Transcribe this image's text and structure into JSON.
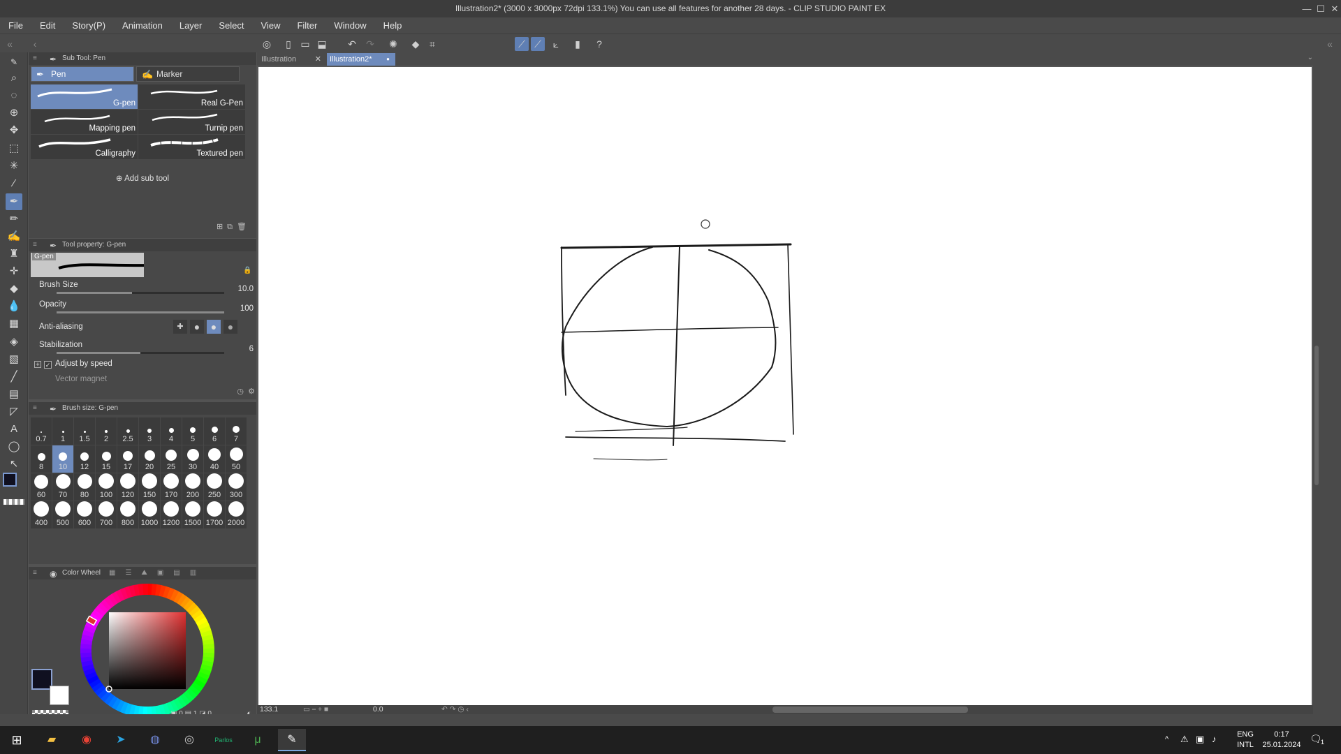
{
  "window": {
    "title": "Illustration2* (3000 x 3000px 72dpi 133.1%)  You can use all features for another 28 days. - CLIP STUDIO PAINT EX",
    "minimize": "—",
    "maximize": "☐",
    "close": "✕"
  },
  "menu": [
    "File",
    "Edit",
    "Story(P)",
    "Animation",
    "Layer",
    "Select",
    "View",
    "Filter",
    "Window",
    "Help"
  ],
  "subtool_panel": {
    "header": "Sub Tool: Pen",
    "tabs": [
      "Pen",
      "Marker"
    ],
    "brushes": [
      "G-pen",
      "Real G-Pen",
      "Mapping pen",
      "Turnip pen",
      "Calligraphy",
      "Textured pen"
    ],
    "add_sub_tool": "Add sub tool"
  },
  "tool_property": {
    "header": "Tool property: G-pen",
    "preview_label": "G-pen",
    "brush_size_label": "Brush Size",
    "brush_size_value": "10.0",
    "brush_size_level": 0.45,
    "opacity_label": "Opacity",
    "opacity_value": "100",
    "opacity_level": 1.0,
    "anti_aliasing_label": "Anti-aliasing",
    "stabilization_label": "Stabilization",
    "stabilization_value": "6",
    "stabilization_level": 0.5,
    "adjust_by_speed_label": "Adjust by speed",
    "adjust_by_speed_checked": true,
    "vector_magnet_label": "Vector magnet"
  },
  "brush_size_panel": {
    "header": "Brush size: G-pen",
    "sizes": [
      "0.7",
      "1",
      "1.5",
      "2",
      "2.5",
      "3",
      "4",
      "5",
      "6",
      "7",
      "8",
      "10",
      "12",
      "15",
      "17",
      "20",
      "25",
      "30",
      "40",
      "50",
      "60",
      "70",
      "80",
      "100",
      "120",
      "150",
      "170",
      "200",
      "250",
      "300",
      "400",
      "500",
      "600",
      "700",
      "800",
      "1000",
      "1200",
      "1500",
      "1700",
      "2000"
    ],
    "selected": "10"
  },
  "color_panel": {
    "header": "Color Wheel",
    "main_color": "#101020",
    "sub_color": "#ffffff",
    "hue_color": "#e03030",
    "counters": [
      "0",
      "1",
      "0"
    ]
  },
  "documents": {
    "tabs": [
      "Illustration",
      "Illustration2*"
    ],
    "active": "Illustration2*",
    "close_glyph": "✕",
    "modified_glyph": "●"
  },
  "status_bar": {
    "zoom": "133.1",
    "rotation": "0.0"
  },
  "taskbar": {
    "lang_top": "ENG",
    "lang_bottom": "INTL",
    "time": "0:17",
    "date": "25.01.2024",
    "notification_count": "1",
    "app_label": "Parlos"
  },
  "icons": {
    "toolbox": [
      "brush-small-icon",
      "zoom-icon",
      "lasso-select-icon",
      "object-select-icon",
      "move-icon",
      "rect-select-icon",
      "magic-wand-icon",
      "eyedropper-icon",
      "pen-icon",
      "pencil-icon",
      "marker-icon",
      "airbrush-icon",
      "decoration-icon",
      "eraser-icon",
      "blend-icon",
      "figure-icon",
      "fill-icon",
      "gradient-icon",
      "line-icon",
      "frame-icon",
      "ruler-icon",
      "text-icon",
      "balloon-icon",
      "correct-line-icon"
    ]
  }
}
